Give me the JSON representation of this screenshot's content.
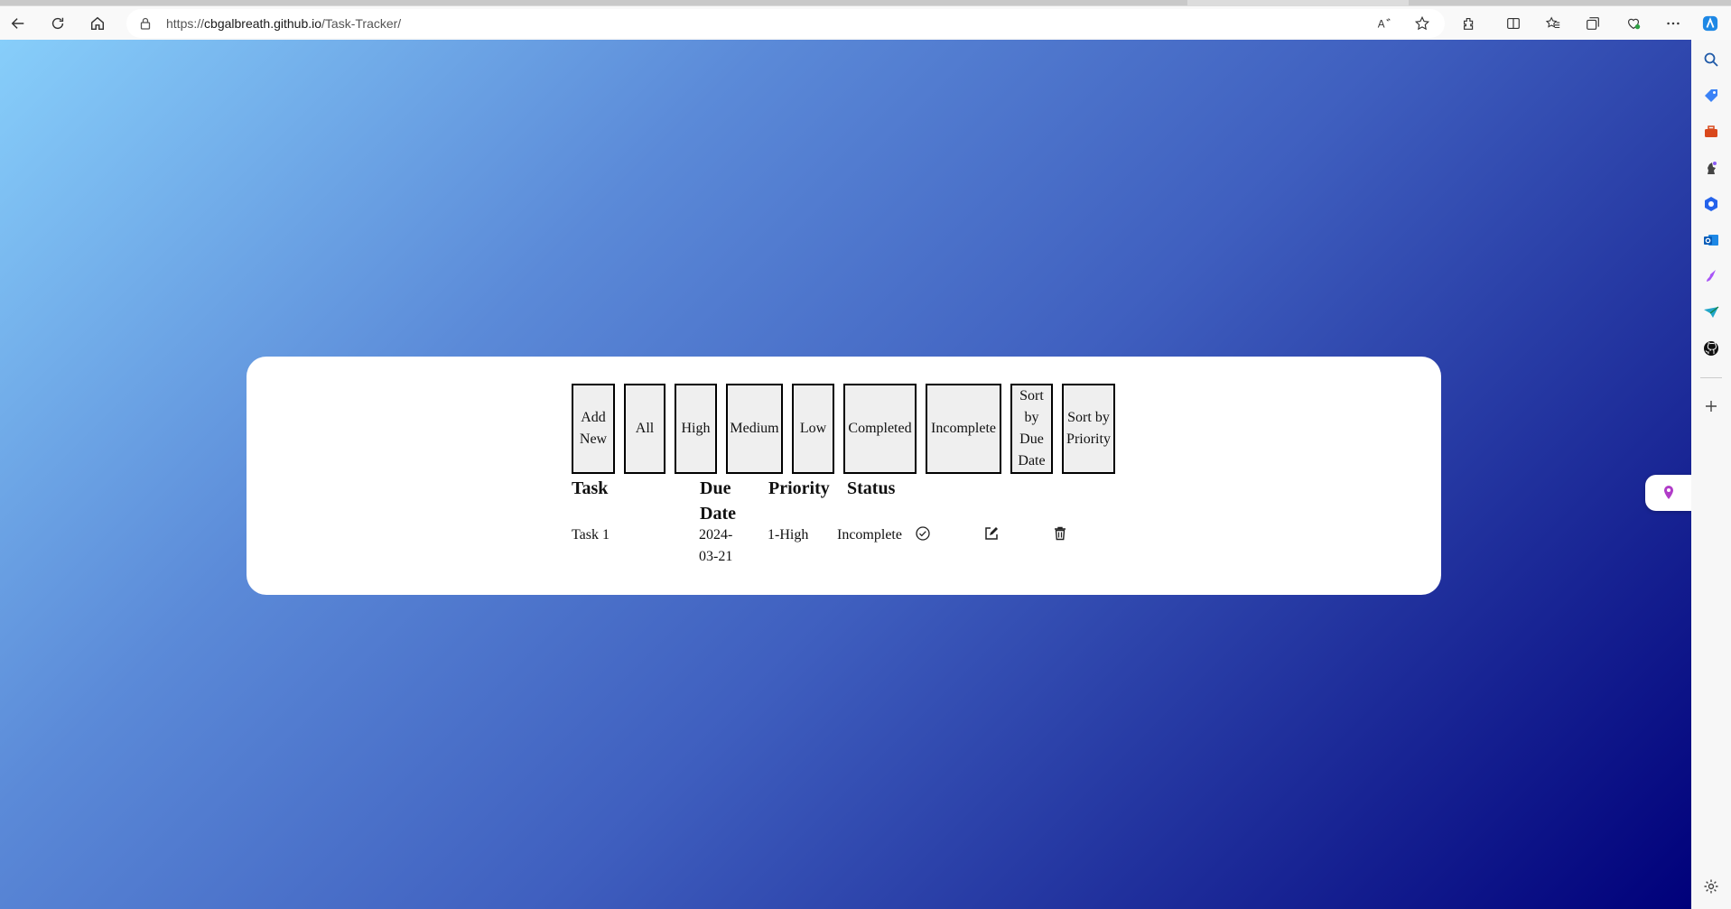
{
  "browser": {
    "url_prefix": "https://",
    "url_host": "cbgalbreath.github.io",
    "url_path": "/Task-Tracker/",
    "toolbar_icons": [
      "back-icon",
      "refresh-icon",
      "home-icon",
      "lock-icon",
      "read-aloud-icon",
      "favorite-star-icon",
      "extensions-icon",
      "split-screen-icon",
      "favorites-icon",
      "collections-icon",
      "browser-essentials-icon",
      "more-icon",
      "copilot-icon"
    ],
    "read_aloud_label": "A̅ʼ"
  },
  "sidebar": {
    "icons": [
      "search-icon",
      "shopping-tag-icon",
      "tools-icon",
      "games-icon",
      "microsoft365-icon",
      "outlook-icon",
      "designer-icon",
      "drop-icon",
      "github-icon",
      "add-icon",
      "settings-icon"
    ]
  },
  "app": {
    "buttons": {
      "add_new": "Add New",
      "all": "All",
      "high": "High",
      "medium": "Medium",
      "low": "Low",
      "completed": "Completed",
      "incomplete": "Incomplete",
      "sort_due": "Sort by Due Date",
      "sort_priority": "Sort by Priority"
    },
    "columns": {
      "task": "Task",
      "due_date": "Due Date",
      "priority": "Priority",
      "status": "Status"
    },
    "tasks": [
      {
        "name": "Task 1",
        "due": "2024-03-21",
        "priority": "1-High",
        "status": "Incomplete"
      }
    ]
  },
  "colors": {
    "gradient_start": "#87cefa",
    "gradient_end": "#00007a",
    "card": "#ffffff",
    "button_bg": "#efefef"
  }
}
